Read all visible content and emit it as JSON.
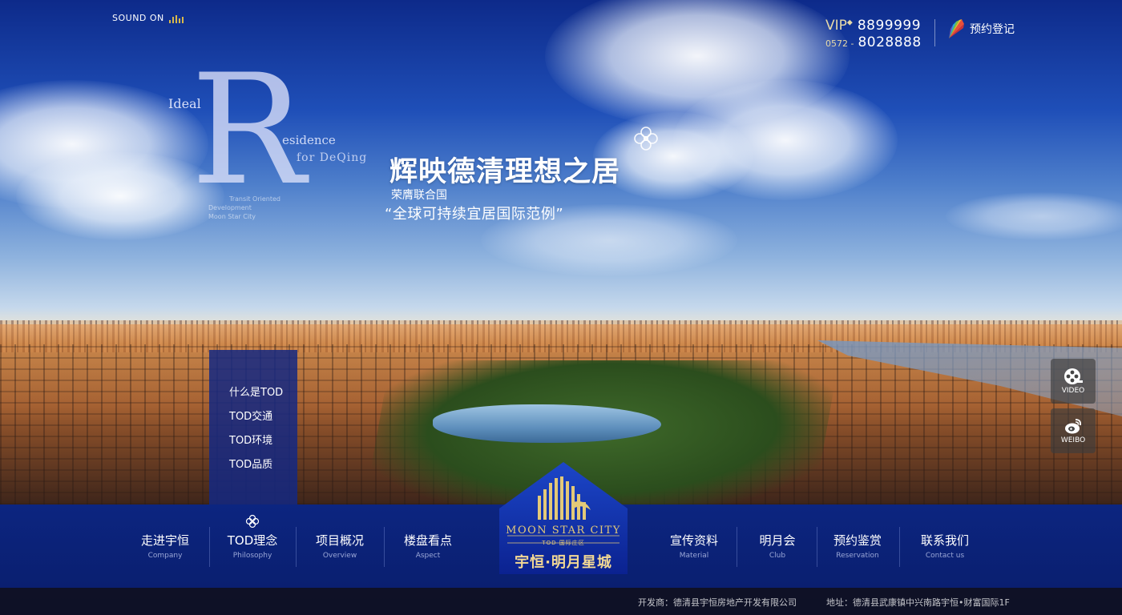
{
  "sound": {
    "label": "SOUND ON"
  },
  "contact": {
    "vip_label": "VIP",
    "vip_number": "8899999",
    "area_code": "0572 -",
    "phone_number": "8028888",
    "register_label": "预约登记"
  },
  "brand_mark": {
    "big_letter": "R",
    "ideal": "Ideal",
    "residence": "esidence",
    "for_deqing": "for DeQing",
    "tod_line1": "Transit Oriented",
    "tod_line2": "Development",
    "tod_line3": "Moon Star City"
  },
  "hero": {
    "headline": "辉映德清理想之居",
    "sub1": "荣膺联合国",
    "sub2": "“全球可持续宜居国际范例”"
  },
  "side_menu": {
    "items": [
      "什么是TOD",
      "TOD交通",
      "TOD环境",
      "TOD品质"
    ]
  },
  "floating": {
    "video_label": "VIDEO",
    "weibo_label": "WEIBO"
  },
  "nav": {
    "items": [
      {
        "cn": "走进宇恒",
        "en": "Company"
      },
      {
        "cn": "TOD理念",
        "en": "Philosophy"
      },
      {
        "cn": "项目概况",
        "en": "Overview"
      },
      {
        "cn": "楼盘看点",
        "en": "Aspect"
      },
      {
        "cn": "宣传资料",
        "en": "Material"
      },
      {
        "cn": "明月会",
        "en": "Club"
      },
      {
        "cn": "预约鉴赏",
        "en": "Reservation"
      },
      {
        "cn": "联系我们",
        "en": "Contact us"
      }
    ]
  },
  "logo": {
    "title": "MOON STAR CITY",
    "tod": "TOD 国际庄区",
    "cn": "宇恒·明月星城"
  },
  "footer": {
    "developer": "开发商：德清县宇恒房地产开发有限公司",
    "address": "地址：德清县武康镇中兴南路宇恒•财富国际1F"
  },
  "colors": {
    "nav_bg": "#0c2580",
    "gold": "#e3c978",
    "side_menu_bg": "#14288a"
  }
}
